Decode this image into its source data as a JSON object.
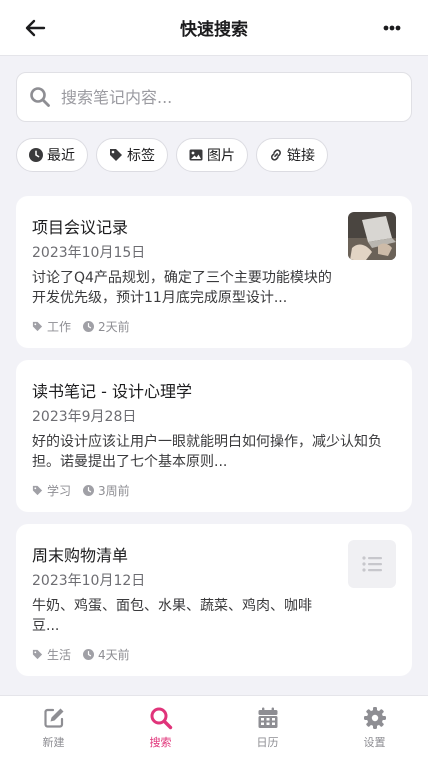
{
  "header": {
    "title": "快速搜索"
  },
  "search": {
    "placeholder": "搜索笔记内容...",
    "value": ""
  },
  "filters": [
    {
      "label": "最近",
      "icon": "clock-icon"
    },
    {
      "label": "标签",
      "icon": "tag-icon"
    },
    {
      "label": "图片",
      "icon": "image-icon"
    },
    {
      "label": "链接",
      "icon": "link-icon"
    }
  ],
  "notes": [
    {
      "title": "项目会议记录",
      "date": "2023年10月15日",
      "body": "讨论了Q4产品规划，确定了三个主要功能模块的开发优先级，预计11月底完成原型设计...",
      "tag": "工作",
      "time": "2天前",
      "thumbnail": "laptop-photo"
    },
    {
      "title": "读书笔记 - 设计心理学",
      "date": "2023年9月28日",
      "body": "好的设计应该让用户一眼就能明白如何操作，减少认知负担。诺曼提出了七个基本原则...",
      "tag": "学习",
      "time": "3周前"
    },
    {
      "title": "周末购物清单",
      "date": "2023年10月12日",
      "body": "牛奶、鸡蛋、面包、水果、蔬菜、鸡肉、咖啡豆...",
      "tag": "生活",
      "time": "4天前",
      "thumbnail": "list-icon"
    }
  ],
  "tabbar": [
    {
      "label": "新建",
      "icon": "edit-icon",
      "active": false
    },
    {
      "label": "搜索",
      "icon": "search-icon",
      "active": true
    },
    {
      "label": "日历",
      "icon": "calendar-icon",
      "active": false
    },
    {
      "label": "设置",
      "icon": "gear-icon",
      "active": false
    }
  ],
  "colors": {
    "accent": "#e0347a",
    "background": "#f2f2f7",
    "muted": "#8e8e93"
  }
}
